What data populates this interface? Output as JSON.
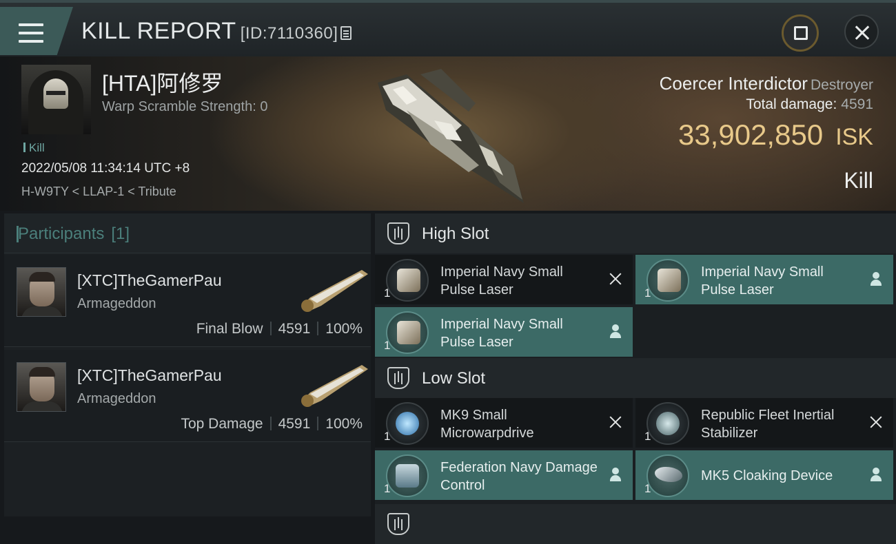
{
  "header": {
    "title": "KILL REPORT",
    "id_label": "[ID:7110360]",
    "menu_icon": "hamburger-icon",
    "share_icon": "share-icon",
    "close_icon": "close-icon"
  },
  "victim": {
    "name": "[HTA]阿修罗",
    "warp_scramble": "Warp Scramble Strength: 0",
    "kill_tag": "Kill",
    "datetime": "2022/05/08 11:34:14 UTC +8",
    "location": "H-W9TY < LLAP-1 < Tribute",
    "ship": "Coercer Interdictor",
    "ship_class": "Destroyer",
    "total_damage_label": "Total damage:",
    "total_damage": "4591",
    "isk_value": "33,902,850",
    "isk_unit": "ISK",
    "result": "Kill"
  },
  "participants": {
    "title": "Participants",
    "count": "[1]",
    "items": [
      {
        "name": "[XTC]TheGamerPau",
        "ship": "Armageddon",
        "role": "Final Blow",
        "damage": "4591",
        "percent": "100%"
      },
      {
        "name": "[XTC]TheGamerPau",
        "ship": "Armageddon",
        "role": "Top Damage",
        "damage": "4591",
        "percent": "100%"
      }
    ]
  },
  "slots": {
    "high_label": "High Slot",
    "low_label": "Low Slot",
    "high": [
      {
        "name": "Imperial Navy Small Pulse Laser",
        "qty": "1",
        "status": "destroyed"
      },
      {
        "name": "Imperial Navy Small Pulse Laser",
        "qty": "1",
        "status": "dropped"
      },
      {
        "name": "Imperial Navy Small Pulse Laser",
        "qty": "1",
        "status": "dropped"
      }
    ],
    "low": [
      {
        "name": "MK9 Small Microwarpdrive",
        "qty": "1",
        "status": "destroyed"
      },
      {
        "name": "Republic Fleet Inertial Stabilizer",
        "qty": "1",
        "status": "destroyed"
      },
      {
        "name": "Federation Navy Damage Control",
        "qty": "1",
        "status": "dropped"
      },
      {
        "name": "MK5 Cloaking Device",
        "qty": "1",
        "status": "dropped"
      }
    ]
  },
  "colors": {
    "isk": "#e8c98a",
    "dropped": "#3c6a66",
    "accent": "#4b7f7b"
  }
}
